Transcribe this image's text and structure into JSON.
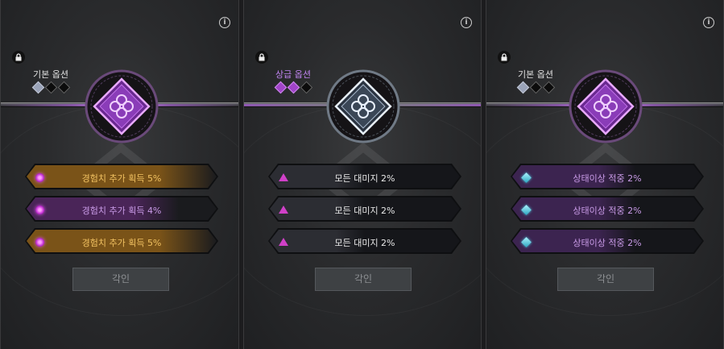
{
  "panels": [
    {
      "option_label": "기본 옵션",
      "option_type": "basic",
      "gems": [
        "basic-on",
        "off",
        "off"
      ],
      "emblem_color": "#a040d8",
      "rows": [
        {
          "text": "경험치 추가 획득 5%",
          "icon": "circle-gem-icon",
          "fill_color": "#7a5318",
          "text_color": "#f0c060",
          "fill_level": 1.0
        },
        {
          "text": "경험치 추가 획득 4%",
          "icon": "circle-gem-icon",
          "fill_color": "#4a2558",
          "text_color": "#c89ae6",
          "fill_level": 0.8
        },
        {
          "text": "경험치 추가 획득 5%",
          "icon": "circle-gem-icon",
          "fill_color": "#7a5318",
          "text_color": "#f0c060",
          "fill_level": 1.0
        }
      ],
      "button_label": "각인"
    },
    {
      "option_label": "상급 옵션",
      "option_type": "bonus",
      "gems": [
        "purple-on",
        "purple-on",
        "off"
      ],
      "emblem_color": "#8a9ab0",
      "rows": [
        {
          "text": "모든 대미지 2%",
          "icon": "triangle-gem-icon",
          "fill_color": "#2c2d33",
          "text_color": "#e8e8e8",
          "fill_level": 0.5
        },
        {
          "text": "모든 대미지 2%",
          "icon": "triangle-gem-icon",
          "fill_color": "#2c2d33",
          "text_color": "#e8e8e8",
          "fill_level": 0.5
        },
        {
          "text": "모든 대미지 2%",
          "icon": "triangle-gem-icon",
          "fill_color": "#2c2d33",
          "text_color": "#e8e8e8",
          "fill_level": 0.5
        }
      ],
      "button_label": "각인"
    },
    {
      "option_label": "기본 옵션",
      "option_type": "basic",
      "gems": [
        "basic-on",
        "off",
        "off"
      ],
      "emblem_color": "#a040d8",
      "rows": [
        {
          "text": "상태이상 적중 2%",
          "icon": "diamond-gem-icon",
          "fill_color": "#3c2450",
          "text_color": "#c89ae6",
          "fill_level": 0.65
        },
        {
          "text": "상태이상 적중 2%",
          "icon": "diamond-gem-icon",
          "fill_color": "#3c2450",
          "text_color": "#c89ae6",
          "fill_level": 0.65
        },
        {
          "text": "상태이상 적중 2%",
          "icon": "diamond-gem-icon",
          "fill_color": "#3c2450",
          "text_color": "#c89ae6",
          "fill_level": 0.65
        }
      ],
      "button_label": "각인"
    }
  ],
  "colors": {
    "accent_purple": "#c084f0",
    "bar_glow": "#b060e0",
    "button_bg": "#3e4144"
  }
}
